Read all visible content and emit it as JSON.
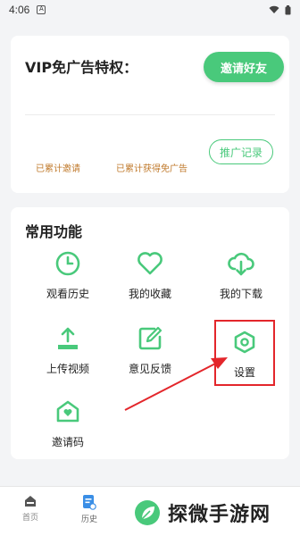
{
  "status": {
    "time": "4:06"
  },
  "vip": {
    "title": "VIP免广告特权：",
    "invite_button": "邀请好友",
    "stat_invited_label": "已累计邀请",
    "stat_earned_label": "已累计获得免广告",
    "record_button": "推广记录"
  },
  "functions": {
    "title": "常用功能",
    "items": [
      {
        "label": "观看历史",
        "icon": "clock-icon"
      },
      {
        "label": "我的收藏",
        "icon": "heart-icon"
      },
      {
        "label": "我的下载",
        "icon": "cloud-download-icon"
      },
      {
        "label": "上传视频",
        "icon": "upload-icon"
      },
      {
        "label": "意见反馈",
        "icon": "feedback-edit-icon"
      },
      {
        "label": "设置",
        "icon": "settings-hexagon-icon"
      },
      {
        "label": "邀请码",
        "icon": "envelope-heart-icon"
      }
    ]
  },
  "tabbar": {
    "tabs": [
      {
        "label": "首页",
        "icon": "home-icon"
      },
      {
        "label": "历史",
        "icon": "history-doc-icon"
      }
    ]
  },
  "watermark": {
    "text": "探微手游网"
  },
  "colors": {
    "accent": "#49c97b",
    "highlight": "#e3262b",
    "stat_text": "#c07a2c"
  }
}
